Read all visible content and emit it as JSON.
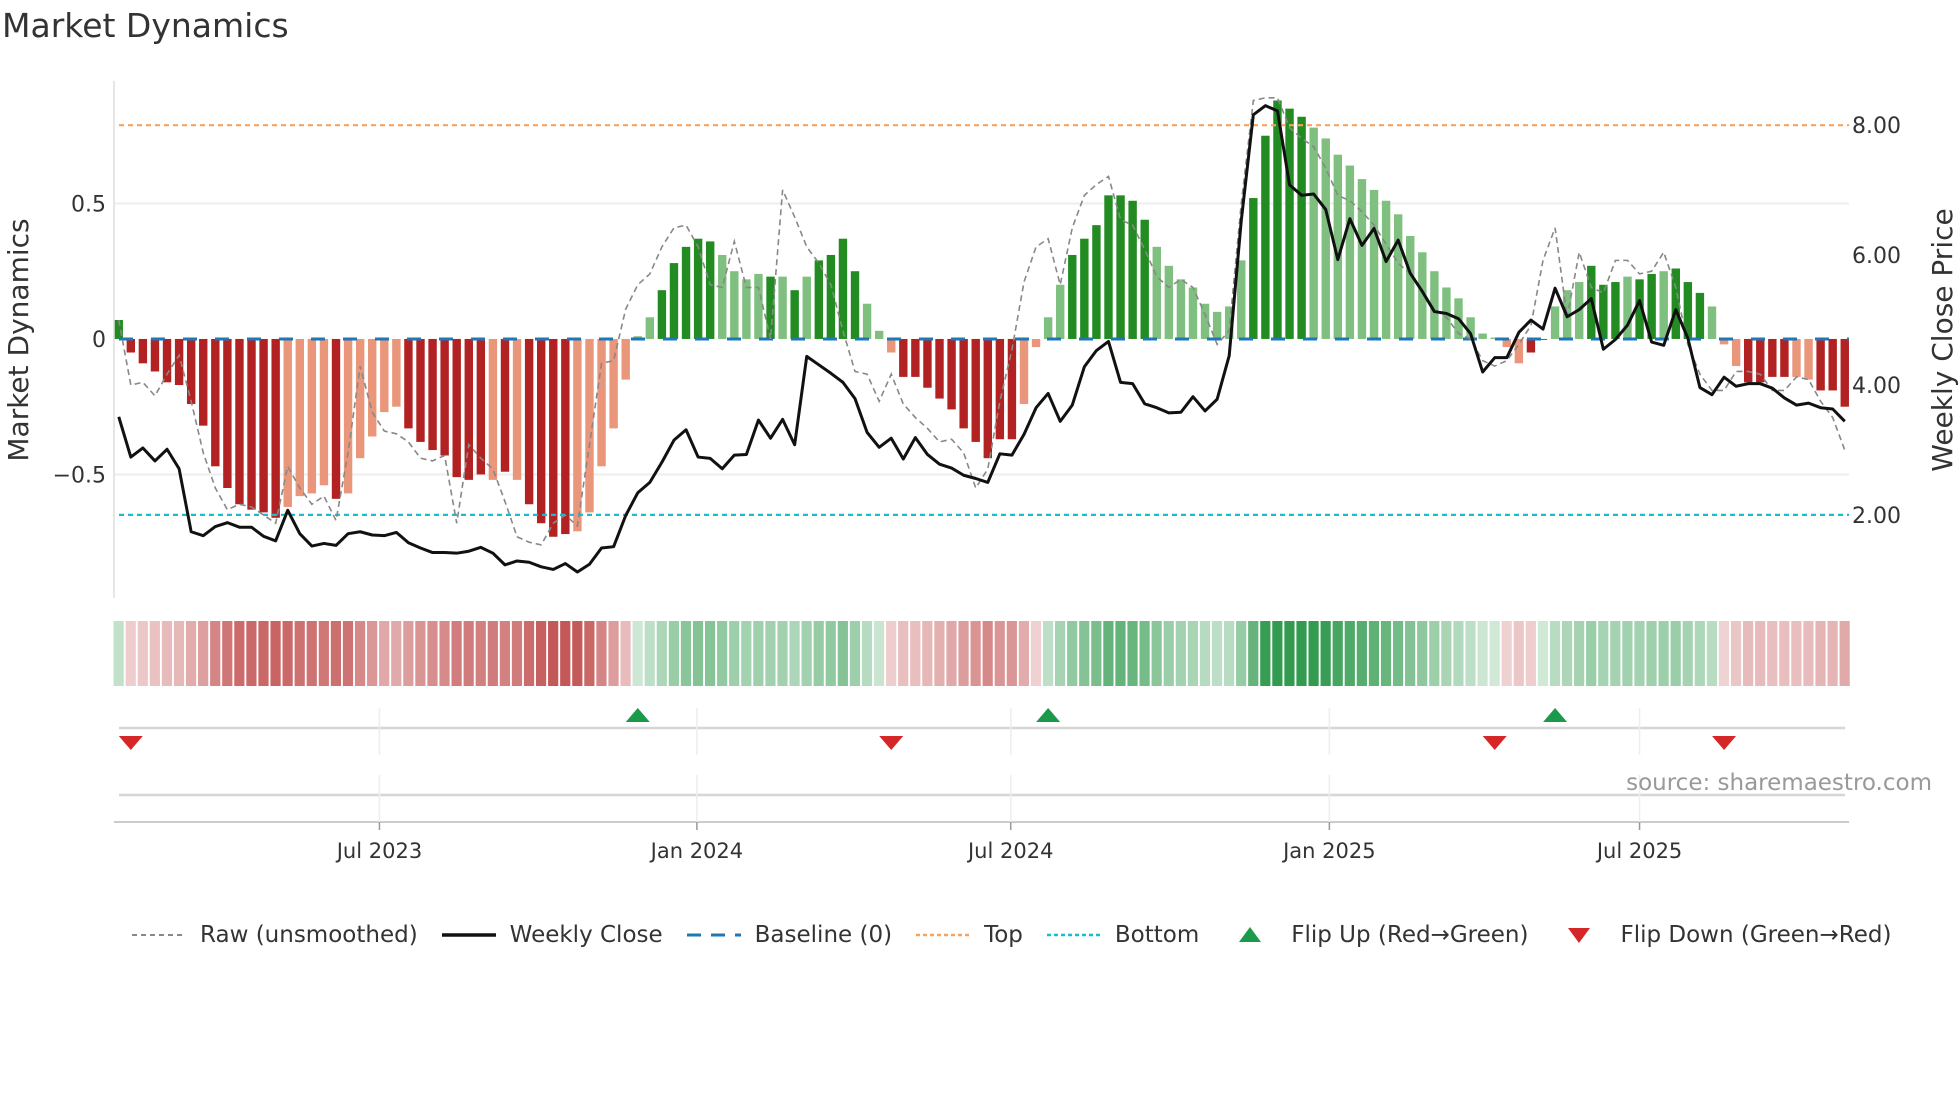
{
  "title": "Market Dynamics",
  "source": "source: sharemaestro.com",
  "legend": [
    {
      "key": "raw",
      "label": "Raw (unsmoothed)"
    },
    {
      "key": "close",
      "label": "Weekly Close"
    },
    {
      "key": "baseline",
      "label": "Baseline (0)"
    },
    {
      "key": "top",
      "label": "Top"
    },
    {
      "key": "bottom",
      "label": "Bottom"
    },
    {
      "key": "flipup",
      "label": "Flip Up (Red→Green)"
    },
    {
      "key": "flipdown",
      "label": "Flip Down (Green→Red)"
    }
  ],
  "colors": {
    "pos_strong": "#228b22",
    "pos_weak": "#7fbf7f",
    "neg_strong": "#b22222",
    "neg_weak": "#e9967a",
    "close": "#111111",
    "raw": "#888888",
    "baseline": "#1f77b4",
    "top": "#f4a460",
    "bottom": "#17becf",
    "flip_up": "#1a9a4a",
    "flip_down": "#d62728",
    "grid": "#eeeeee"
  },
  "chart_data": {
    "type": "bar",
    "title": "Market Dynamics",
    "ylabel": "Market Dynamics",
    "y2label": "Weekly Close Price",
    "ylim": [
      -0.956,
      0.952
    ],
    "y2lim": [
      0.72,
      8.68
    ],
    "yticks": [
      {
        "v": 0.5,
        "label": "0.5"
      },
      {
        "v": 0,
        "label": "0"
      },
      {
        "v": -0.5,
        "label": "−0.5"
      }
    ],
    "y2ticks": [
      {
        "v": 8,
        "label": "8.00"
      },
      {
        "v": 6,
        "label": "6.00"
      },
      {
        "v": 4,
        "label": "4.00"
      },
      {
        "v": 2,
        "label": "2.00"
      }
    ],
    "xticks": [
      {
        "week": 21.6,
        "label": "Jul 2023"
      },
      {
        "week": 47.9,
        "label": "Jan 2024"
      },
      {
        "week": 73.9,
        "label": "Jul 2024"
      },
      {
        "week": 100.3,
        "label": "Jan 2025"
      },
      {
        "week": 126.0,
        "label": "Jul 2025"
      }
    ],
    "top_price": 8.0,
    "bottom_price": 2.0,
    "baseline": 0,
    "values": [
      0.07,
      -0.05,
      -0.09,
      -0.12,
      -0.16,
      -0.17,
      -0.24,
      -0.32,
      -0.47,
      -0.55,
      -0.61,
      -0.63,
      -0.64,
      -0.66,
      -0.62,
      -0.58,
      -0.57,
      -0.54,
      -0.59,
      -0.57,
      -0.44,
      -0.36,
      -0.27,
      -0.25,
      -0.33,
      -0.38,
      -0.41,
      -0.43,
      -0.51,
      -0.52,
      -0.5,
      -0.52,
      -0.49,
      -0.52,
      -0.61,
      -0.68,
      -0.73,
      -0.72,
      -0.71,
      -0.64,
      -0.47,
      -0.33,
      -0.15,
      0.01,
      0.08,
      0.18,
      0.28,
      0.34,
      0.37,
      0.36,
      0.31,
      0.25,
      0.22,
      0.24,
      0.23,
      0.23,
      0.18,
      0.23,
      0.29,
      0.31,
      0.37,
      0.25,
      0.13,
      0.03,
      -0.05,
      -0.14,
      -0.14,
      -0.18,
      -0.22,
      -0.26,
      -0.33,
      -0.38,
      -0.44,
      -0.37,
      -0.37,
      -0.24,
      -0.03,
      0.08,
      0.2,
      0.31,
      0.37,
      0.42,
      0.53,
      0.53,
      0.51,
      0.44,
      0.34,
      0.27,
      0.22,
      0.19,
      0.13,
      0.1,
      0.12,
      0.29,
      0.52,
      0.75,
      0.88,
      0.85,
      0.82,
      0.78,
      0.74,
      0.68,
      0.64,
      0.59,
      0.55,
      0.51,
      0.46,
      0.38,
      0.32,
      0.25,
      0.19,
      0.15,
      0.08,
      0.02,
      0.005,
      -0.03,
      -0.09,
      -0.05,
      0.0,
      0.12,
      0.18,
      0.21,
      0.27,
      0.2,
      0.21,
      0.23,
      0.22,
      0.24,
      0.25,
      0.26,
      0.21,
      0.17,
      0.12,
      -0.02,
      -0.1,
      -0.16,
      -0.16,
      -0.14,
      -0.14,
      -0.14,
      -0.15,
      -0.19,
      -0.19,
      -0.25
    ],
    "shade": "ddddddddddddddlllldllllldddddddldlddddllllllldddddlllldldlddddlllddddddddddlllldddddddllllllllddddd",
    "shade_tail": "llllllllllllllllllddllldddlddldddllldddd",
    "shade_end": "llddddd",
    "raw": [
      0.07,
      -0.17,
      -0.16,
      -0.21,
      -0.13,
      -0.06,
      -0.23,
      -0.42,
      -0.55,
      -0.63,
      -0.61,
      -0.62,
      -0.65,
      -0.68,
      -0.47,
      -0.55,
      -0.61,
      -0.58,
      -0.67,
      -0.42,
      -0.1,
      -0.27,
      -0.34,
      -0.35,
      -0.38,
      -0.44,
      -0.45,
      -0.43,
      -0.68,
      -0.39,
      -0.44,
      -0.48,
      -0.6,
      -0.73,
      -0.75,
      -0.76,
      -0.68,
      -0.65,
      -0.69,
      -0.39,
      -0.09,
      -0.08,
      0.11,
      0.2,
      0.24,
      0.34,
      0.41,
      0.42,
      0.34,
      0.2,
      0.19,
      0.36,
      0.19,
      0.19,
      0.0,
      0.55,
      0.45,
      0.34,
      0.28,
      0.2,
      0.03,
      -0.12,
      -0.13,
      -0.23,
      -0.13,
      -0.24,
      -0.29,
      -0.33,
      -0.38,
      -0.37,
      -0.42,
      -0.55,
      -0.48,
      -0.23,
      -0.04,
      0.21,
      0.34,
      0.37,
      0.2,
      0.41,
      0.53,
      0.57,
      0.6,
      0.44,
      0.42,
      0.33,
      0.23,
      0.19,
      0.22,
      0.19,
      0.09,
      -0.02,
      0.03,
      0.5,
      0.88,
      0.89,
      0.89,
      0.78,
      0.74,
      0.71,
      0.63,
      0.53,
      0.51,
      0.47,
      0.42,
      0.35,
      0.28,
      0.24,
      0.17,
      0.11,
      0.08,
      0.02,
      0.0,
      -0.08,
      -0.1,
      -0.08,
      -0.02,
      0.05,
      0.29,
      0.41,
      0.08,
      0.32,
      0.19,
      0.17,
      0.29,
      0.29,
      0.24,
      0.25,
      0.32,
      0.19,
      -0.02,
      -0.13,
      -0.19,
      -0.19,
      -0.12,
      -0.12,
      -0.13,
      -0.19,
      -0.19,
      -0.14,
      -0.15,
      -0.23,
      -0.29,
      -0.41
    ],
    "close": [
      3.51,
      2.89,
      3.03,
      2.83,
      3.01,
      2.71,
      1.74,
      1.68,
      1.82,
      1.88,
      1.81,
      1.81,
      1.67,
      1.6,
      2.07,
      1.71,
      1.52,
      1.56,
      1.53,
      1.71,
      1.74,
      1.69,
      1.68,
      1.73,
      1.57,
      1.49,
      1.42,
      1.42,
      1.41,
      1.44,
      1.5,
      1.41,
      1.23,
      1.29,
      1.27,
      1.2,
      1.16,
      1.25,
      1.12,
      1.24,
      1.49,
      1.51,
      1.99,
      2.34,
      2.5,
      2.81,
      3.15,
      3.31,
      2.89,
      2.87,
      2.71,
      2.92,
      2.93,
      3.46,
      3.18,
      3.47,
      3.08,
      4.44,
      4.31,
      4.18,
      4.04,
      3.79,
      3.27,
      3.04,
      3.18,
      2.86,
      3.19,
      2.93,
      2.78,
      2.72,
      2.61,
      2.56,
      2.5,
      2.94,
      2.92,
      3.24,
      3.65,
      3.87,
      3.44,
      3.69,
      4.28,
      4.53,
      4.67,
      4.04,
      4.02,
      3.71,
      3.65,
      3.57,
      3.58,
      3.82,
      3.6,
      3.78,
      4.45,
      6.53,
      8.16,
      8.3,
      8.22,
      7.08,
      6.92,
      6.94,
      6.7,
      5.93,
      6.56,
      6.15,
      6.41,
      5.9,
      6.23,
      5.72,
      5.44,
      5.13,
      5.1,
      5.02,
      4.79,
      4.2,
      4.42,
      4.42,
      4.81,
      5.0,
      4.86,
      5.49,
      5.05,
      5.16,
      5.33,
      4.55,
      4.7,
      4.92,
      5.3,
      4.66,
      4.61,
      5.16,
      4.72,
      3.96,
      3.85,
      4.12,
      3.98,
      4.02,
      4.02,
      3.95,
      3.8,
      3.69,
      3.72,
      3.65,
      3.63,
      3.44
    ],
    "flip_up_weeks": [
      43,
      77,
      119
    ],
    "flip_down_weeks": [
      1,
      64,
      114,
      133
    ]
  }
}
